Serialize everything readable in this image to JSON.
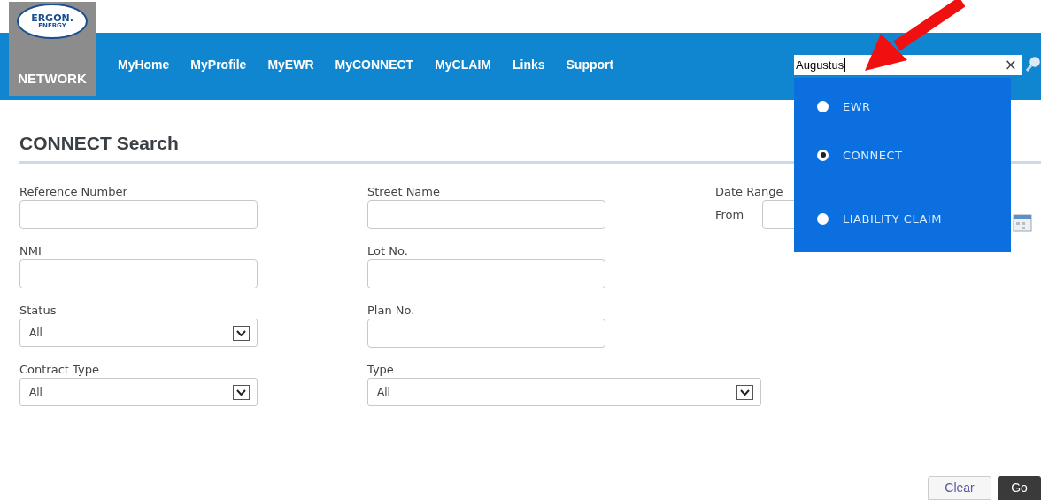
{
  "logo": {
    "lines": [
      "ERGON.",
      "ENERGY"
    ],
    "caption": "NETWORK"
  },
  "nav": [
    "MyHome",
    "MyProfile",
    "MyEWR",
    "MyCONNECT",
    "MyCLAIM",
    "Links",
    "Support"
  ],
  "search": {
    "value": "Augustus",
    "clear": "×"
  },
  "search_scope": [
    {
      "label": "EWR",
      "selected": false
    },
    {
      "label": "CONNECT",
      "selected": true
    },
    {
      "label": "LIABILITY CLAIM",
      "selected": false
    }
  ],
  "title": "CONNECT Search",
  "form_rows": [
    [
      {
        "kind": "text",
        "label": "Reference Number"
      },
      {
        "kind": "text",
        "label": "Street Name"
      },
      {
        "kind": "date_range",
        "label": "Date Range",
        "sub_label": "From"
      }
    ],
    [
      {
        "kind": "text",
        "label": "NMI"
      },
      {
        "kind": "text",
        "label": "Lot No."
      }
    ],
    [
      {
        "kind": "select",
        "label": "Status",
        "value": "All"
      },
      {
        "kind": "text",
        "label": "Plan No."
      }
    ],
    [
      {
        "kind": "select",
        "label": "Contract Type",
        "value": "All"
      },
      {
        "kind": "select",
        "label": "Type",
        "value": "All",
        "wide": true
      }
    ]
  ],
  "buttons": [
    {
      "kind": "secondary",
      "label": "Clear"
    },
    {
      "kind": "primary",
      "label": "Go"
    }
  ]
}
